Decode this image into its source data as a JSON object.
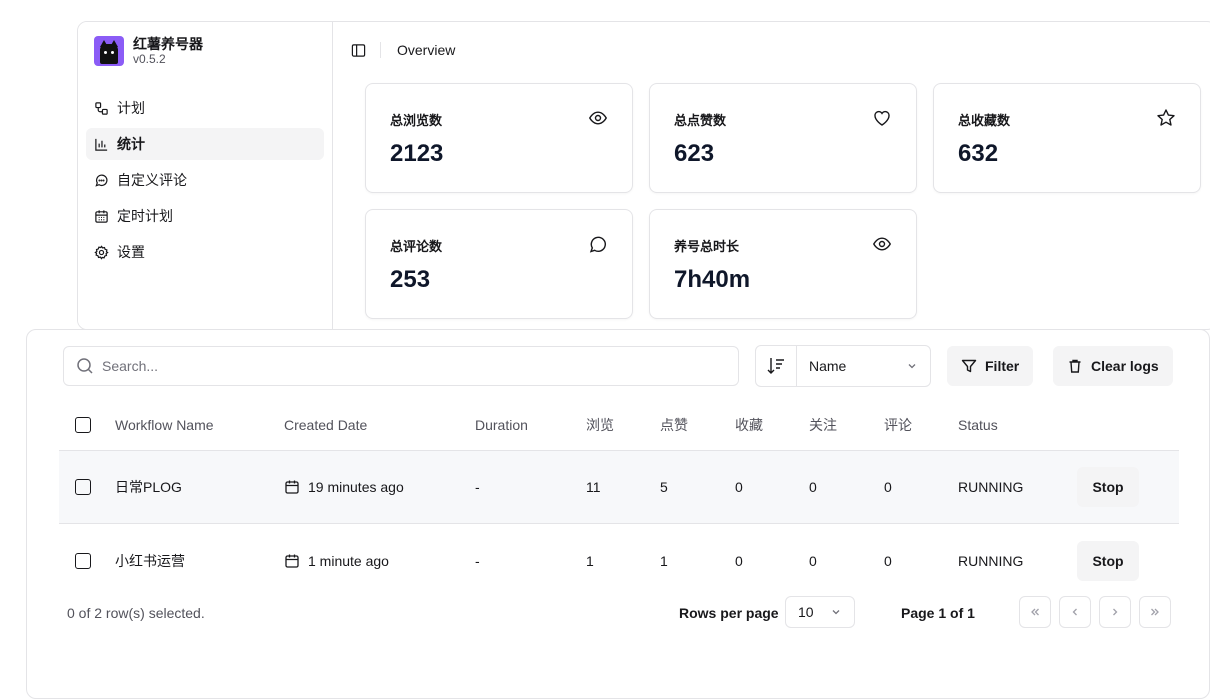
{
  "brand": {
    "title": "红薯养号器",
    "version": "v0.5.2"
  },
  "sidebar": {
    "items": [
      {
        "label": "计划",
        "icon": "workflow-icon"
      },
      {
        "label": "统计",
        "icon": "bar-chart-icon",
        "active": true
      },
      {
        "label": "自定义评论",
        "icon": "message-circle-icon"
      },
      {
        "label": "定时计划",
        "icon": "calendar-icon"
      },
      {
        "label": "设置",
        "icon": "gear-icon"
      }
    ]
  },
  "header": {
    "breadcrumb": "Overview"
  },
  "stats": [
    {
      "label": "总浏览数",
      "value": "2123",
      "icon": "eye-icon"
    },
    {
      "label": "总点赞数",
      "value": "623",
      "icon": "heart-icon"
    },
    {
      "label": "总收藏数",
      "value": "632",
      "icon": "star-icon"
    },
    {
      "label": "总评论数",
      "value": "253",
      "icon": "message-circle-icon"
    },
    {
      "label": "养号总时长",
      "value": "7h40m",
      "icon": "eye-icon"
    }
  ],
  "toolbar": {
    "search_placeholder": "Search...",
    "sort_value": "Name",
    "filter_label": "Filter",
    "clear_label": "Clear logs"
  },
  "table": {
    "headers": [
      "Workflow Name",
      "Created Date",
      "Duration",
      "浏览",
      "点赞",
      "收藏",
      "关注",
      "评论",
      "Status"
    ],
    "rows": [
      {
        "name": "日常PLOG",
        "created": "19 minutes ago",
        "duration": "-",
        "views": "11",
        "likes": "5",
        "favs": "0",
        "follows": "0",
        "comments": "0",
        "status": "RUNNING",
        "action": "Stop"
      },
      {
        "name": "小红书运营",
        "created": "1 minute ago",
        "duration": "-",
        "views": "1",
        "likes": "1",
        "favs": "0",
        "follows": "0",
        "comments": "0",
        "status": "RUNNING",
        "action": "Stop"
      }
    ]
  },
  "footer": {
    "selected_text": "0 of 2 row(s) selected.",
    "rows_per_page_label": "Rows per page",
    "rows_per_page_value": "10",
    "page_text": "Page 1 of 1"
  },
  "colors": {
    "accent": "#18181b",
    "border": "#e4e4e7",
    "muted_bg": "#f4f4f5",
    "logo_bg": "#8b5cf6"
  }
}
